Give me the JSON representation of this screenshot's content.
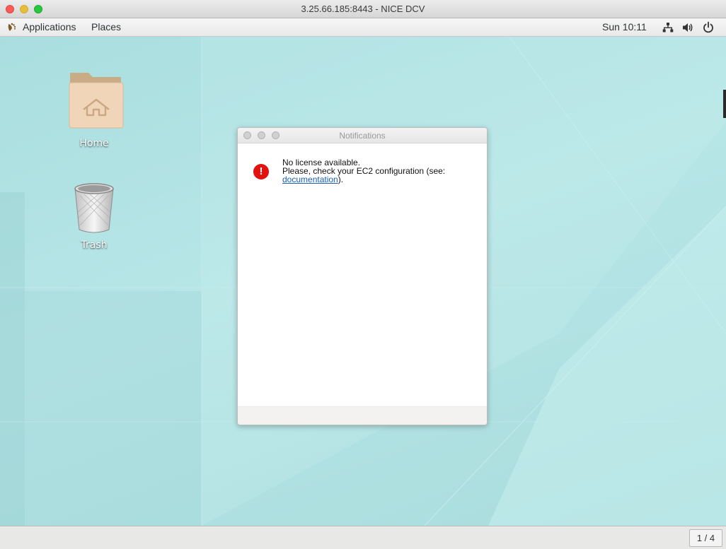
{
  "window": {
    "title": "3.25.66.185:8443 - NICE DCV"
  },
  "topbar": {
    "applications_label": "Applications",
    "places_label": "Places",
    "clock": "Sun 10:11"
  },
  "desktop": {
    "icons": [
      {
        "label": "Home"
      },
      {
        "label": "Trash"
      }
    ]
  },
  "notification": {
    "title": "Notifications",
    "line1": "No license available.",
    "line2": "Please, check your EC2 configuration (see:",
    "link_text": "documentation",
    "line3_suffix": ").",
    "icon_symbol": "!",
    "icon_color": "#e2120e"
  },
  "bottombar": {
    "workspace_indicator": "1 / 4"
  },
  "colors": {
    "desktop_bg": "#b3e3e4",
    "link": "#1a5fb4",
    "mac_close": "#fc5b57",
    "mac_minimize": "#e5bf3c",
    "mac_zoom": "#2ac840"
  }
}
